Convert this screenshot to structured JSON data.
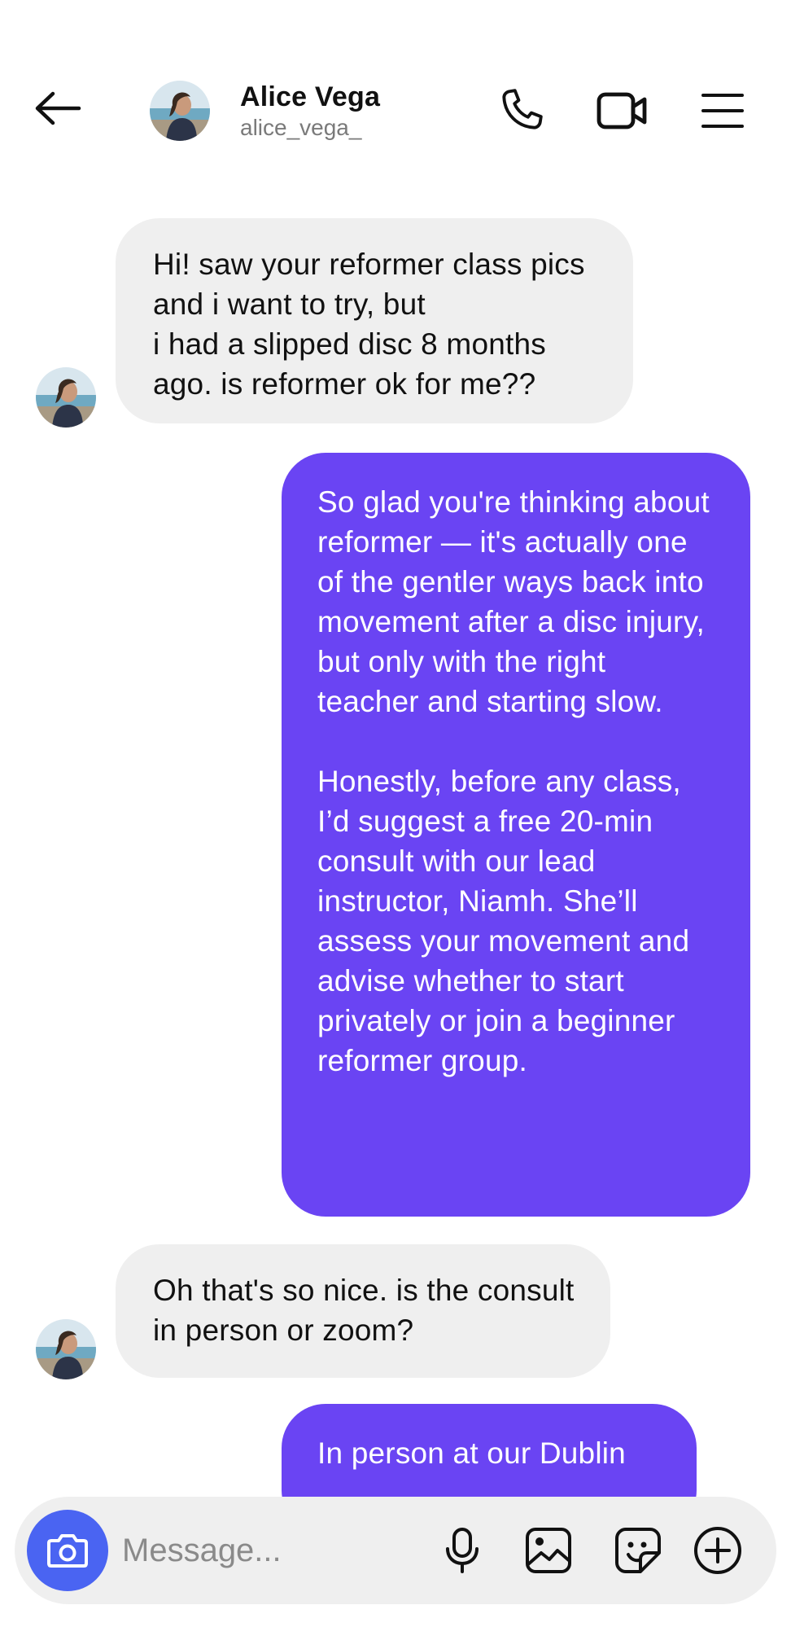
{
  "header": {
    "back_icon": "arrow-left-icon",
    "name": "Alice Vega",
    "handle": "alice_vega_",
    "actions": [
      "phone-icon",
      "video-camera-icon",
      "menu-icon"
    ]
  },
  "messages": [
    {
      "direction": "incoming",
      "text": "Hi! saw your reformer class pics and i want to try, but\ni had a slipped disc 8 months ago. is reformer ok for me??"
    },
    {
      "direction": "outgoing",
      "text": "So glad you're thinking about reformer — it's actually one of the gentler ways back into movement after a disc injury, but only with the right teacher and starting slow.\n\nHonestly, before any class, I’d suggest a free 20-min consult with our lead instructor, Niamh. She’ll assess your movement and advise whether to start privately or join a beginner reformer group."
    },
    {
      "direction": "incoming",
      "text": "Oh that's so nice. is the consult in person or zoom?"
    },
    {
      "direction": "outgoing",
      "text": "In person at our Dublin"
    }
  ],
  "composer": {
    "placeholder": "Message...",
    "icons": [
      "camera-icon",
      "microphone-icon",
      "image-icon",
      "sticker-icon",
      "plus-circle-icon"
    ]
  },
  "colors": {
    "outgoing_bubble": "#6a44f3",
    "incoming_bubble": "#efefef",
    "camera_button": "#4a64f2"
  }
}
